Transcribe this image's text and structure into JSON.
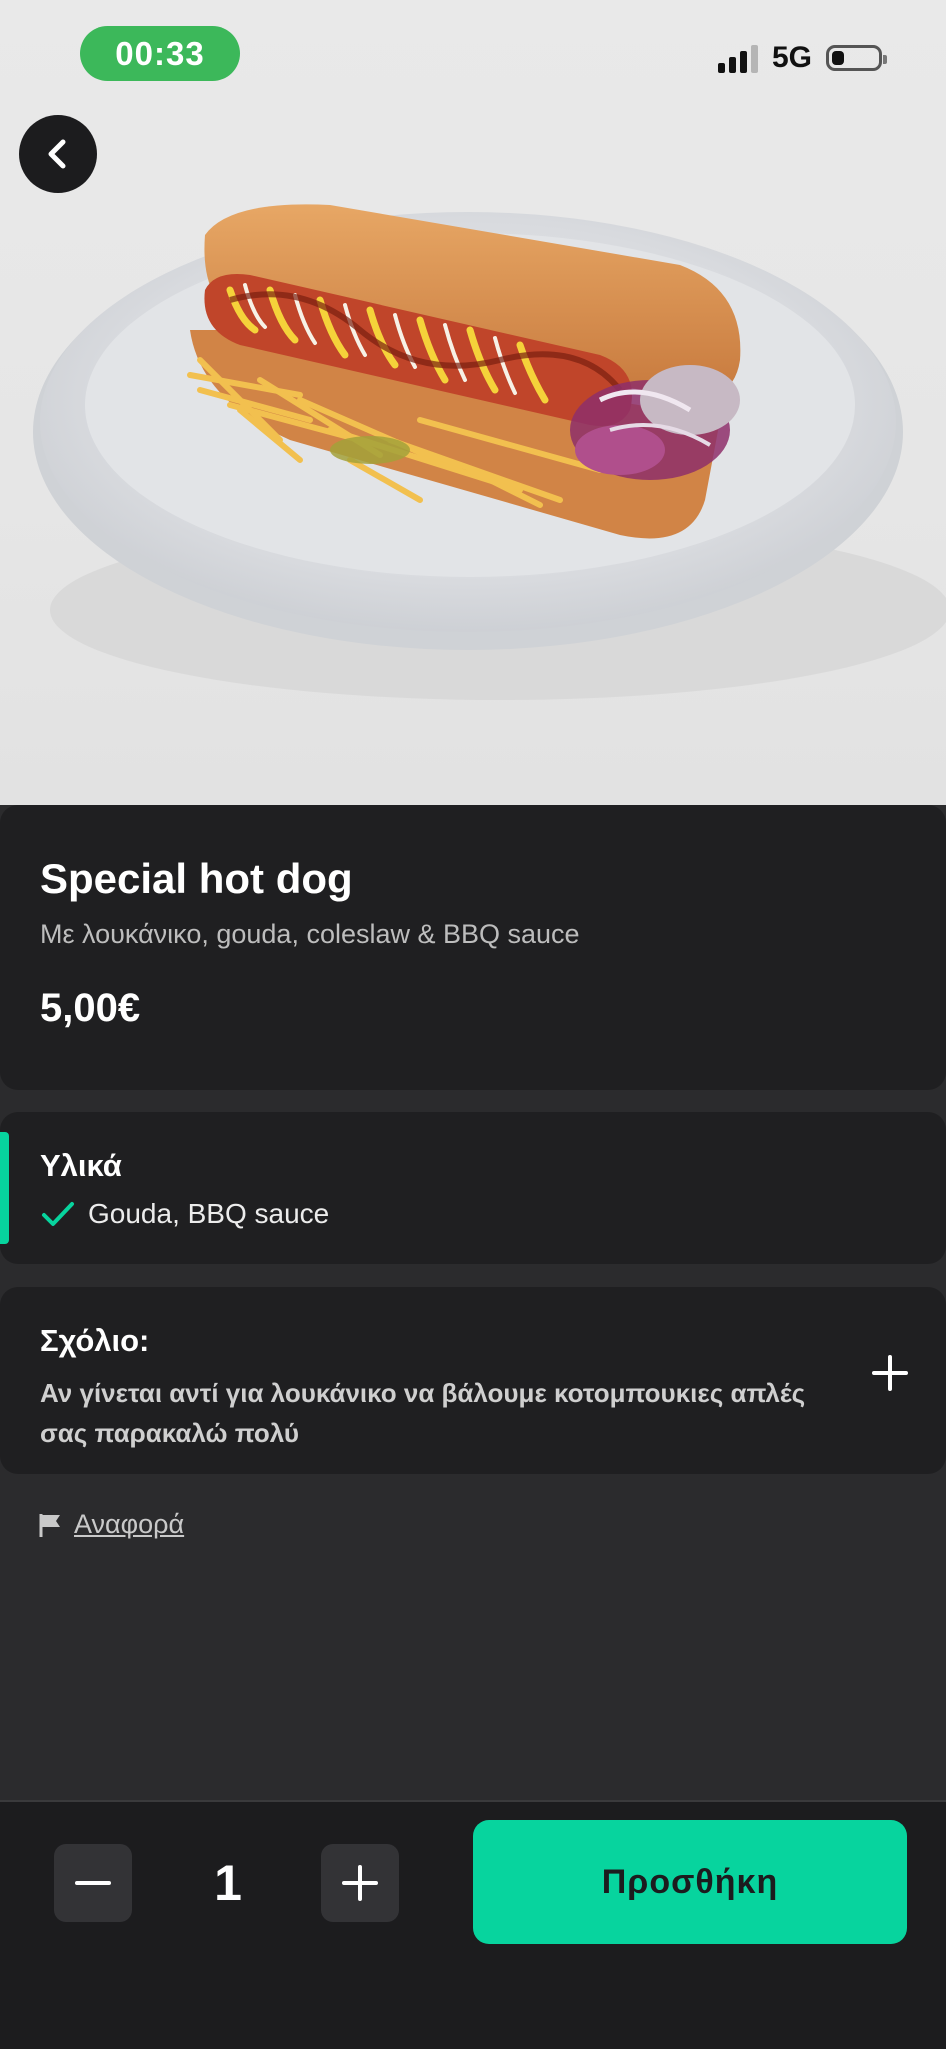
{
  "status_bar": {
    "time": "00:33",
    "network": "5G"
  },
  "product": {
    "title": "Special hot dog",
    "description": "Με λουκάνικο, gouda, coleslaw & BBQ sauce",
    "price": "5,00€",
    "image_alt": "hot dog on a plate"
  },
  "ingredients": {
    "heading": "Υλικά",
    "selected": "Gouda, BBQ sauce"
  },
  "comment": {
    "heading": "Σχόλιο:",
    "text": "Αν γίνεται αντί για λουκάνικο να βάλουμε κοτομπουκιες απλές σας παρακαλώ πολύ"
  },
  "report": {
    "label": "Αναφορά"
  },
  "cart": {
    "quantity": "1",
    "add_label": "Προσθήκη"
  },
  "colors": {
    "accent": "#07d49e",
    "card_bg": "#1f1f21",
    "status_pill": "#3cb85a"
  }
}
